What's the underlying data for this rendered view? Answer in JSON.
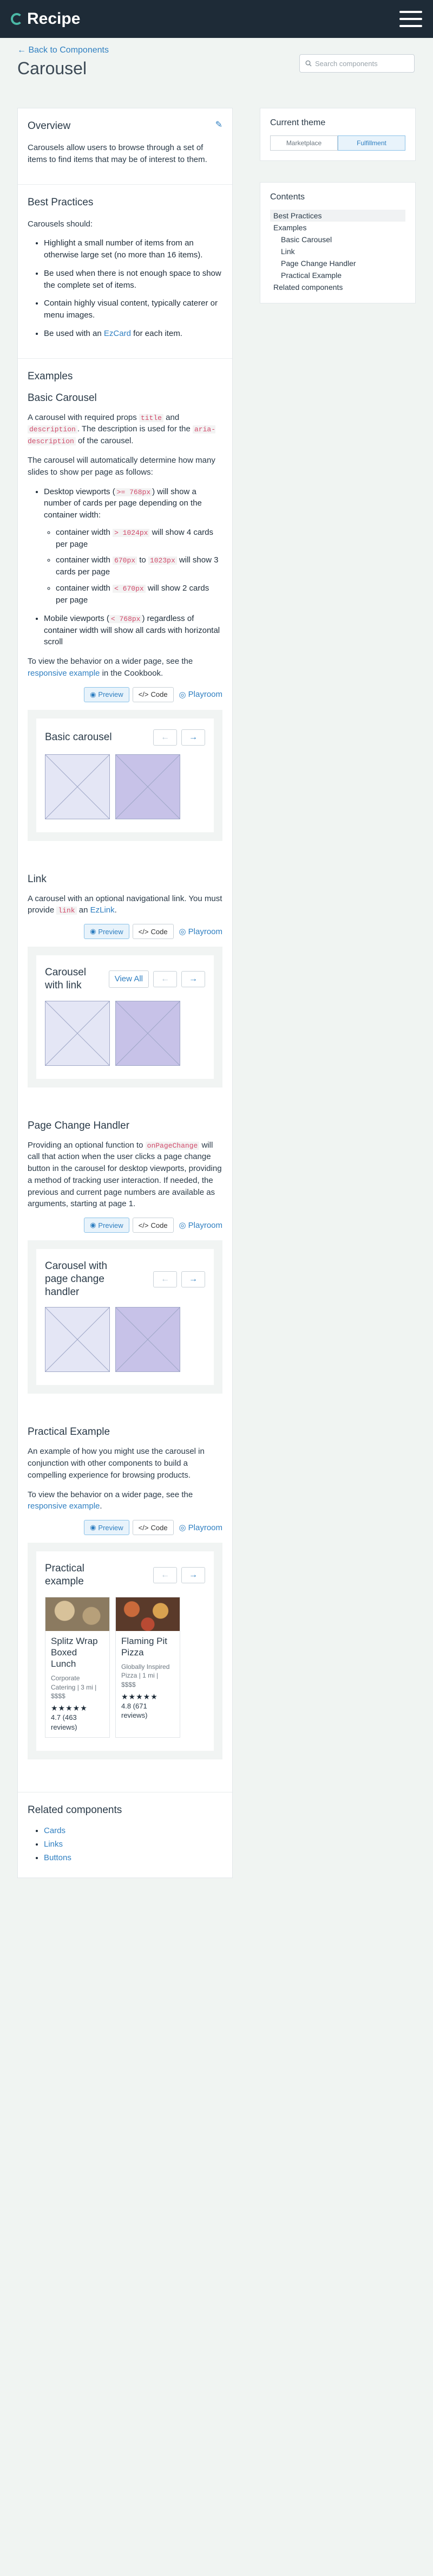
{
  "header": {
    "brand": "Recipe"
  },
  "page": {
    "back_label": "← Back to Components",
    "title": "Carousel",
    "search_placeholder": "Search components"
  },
  "overview": {
    "heading": "Overview",
    "text": "Carousels allow users to browse through a set of items to find items that may be of interest to them."
  },
  "best_practices": {
    "heading": "Best Practices",
    "intro": "Carousels should:",
    "items": [
      "Highlight a small number of items from an otherwise large set (no more than 16 items).",
      "Be used when there is not enough space to show the complete set of items.",
      "Contain highly visual content, typically caterer or menu images."
    ],
    "last_pre": "Be used with an ",
    "last_link": "EzCard",
    "last_post": " for each item."
  },
  "examples": {
    "heading": "Examples",
    "basic": {
      "heading": "Basic Carousel",
      "p1_a": "A carousel with required props ",
      "p1_code1": "title",
      "p1_b": " and ",
      "p1_code2": "description",
      "p1_c": ". The description is used for the ",
      "p1_code3": "aria-description",
      "p1_d": " of the carousel.",
      "p2": "The carousel will automatically determine how many slides to show per page as follows:",
      "desk_a": "Desktop viewports (",
      "desk_code": ">= 768px",
      "desk_b": ") will show a number of cards per page depending on the container width:",
      "sub1_a": "container width ",
      "sub1_code": "> 1024px",
      "sub1_b": " will show 4 cards per page",
      "sub2_a": "container width ",
      "sub2_code1": "670px",
      "sub2_b": " to ",
      "sub2_code2": "1023px",
      "sub2_c": " will show 3 cards per page",
      "sub3_a": "container width ",
      "sub3_code": "< 670px",
      "sub3_b": " will show 2 cards per page",
      "mob_a": "Mobile viewports (",
      "mob_code": "< 768px",
      "mob_b": ") regardless of container width will show all cards with horizontal scroll",
      "p3_a": "To view the behavior on a wider page, see the ",
      "p3_link": "responsive example",
      "p3_b": " in the Cookbook.",
      "demo_title": "Basic carousel"
    },
    "link": {
      "heading": "Link",
      "p_a": "A carousel with an optional navigational link. You must provide ",
      "p_code": "link",
      "p_b": " an ",
      "p_link": "EzLink",
      "p_c": ".",
      "demo_title": "Carousel with link",
      "view_all": "View All"
    },
    "page_change": {
      "heading": "Page Change Handler",
      "p_a": "Providing an optional function to ",
      "p_code": "onPageChange",
      "p_b": " will call that action when the user clicks a page change button in the carousel for desktop viewports, providing a method of tracking user interaction. If needed, the previous and current page numbers are available as arguments, starting at page 1.",
      "demo_title": "Carousel with page change handler"
    },
    "practical": {
      "heading": "Practical Example",
      "p1": "An example of how you might use the carousel in conjunction with other components to build a compelling experience for browsing products.",
      "p2_a": "To view the behavior on a wider page, see the ",
      "p2_link": "responsive example",
      "p2_b": ".",
      "demo_title": "Practical example",
      "cards": [
        {
          "name": "Splitz Wrap Boxed Lunch",
          "meta": "Corporate Catering | 3 mi | $$$$",
          "stars": "★★★★★",
          "rating": "4.7 (463 reviews)"
        },
        {
          "name": "Flaming Pit Pizza",
          "meta": "Globally Inspired Pizza | 1 mi | $$$$",
          "stars": "★★★★★",
          "rating": "4.8 (671 reviews)"
        }
      ]
    }
  },
  "toolbar": {
    "preview": "Preview",
    "code": "Code",
    "playroom": "Playroom"
  },
  "theme": {
    "heading": "Current theme",
    "options": [
      "Marketplace",
      "Fulfillment"
    ],
    "selected": "Fulfillment"
  },
  "contents": {
    "heading": "Contents",
    "items": [
      "Best Practices",
      "Examples",
      "Basic Carousel",
      "Link",
      "Page Change Handler",
      "Practical Example",
      "Related components"
    ]
  },
  "related": {
    "heading": "Related components",
    "items": [
      "Cards",
      "Links",
      "Buttons"
    ]
  },
  "colors": {
    "topbar": "#1e2b37",
    "accent": "#2f7fc1",
    "brand_mark": "#4bb8a6",
    "background": "#f0f4f2"
  }
}
